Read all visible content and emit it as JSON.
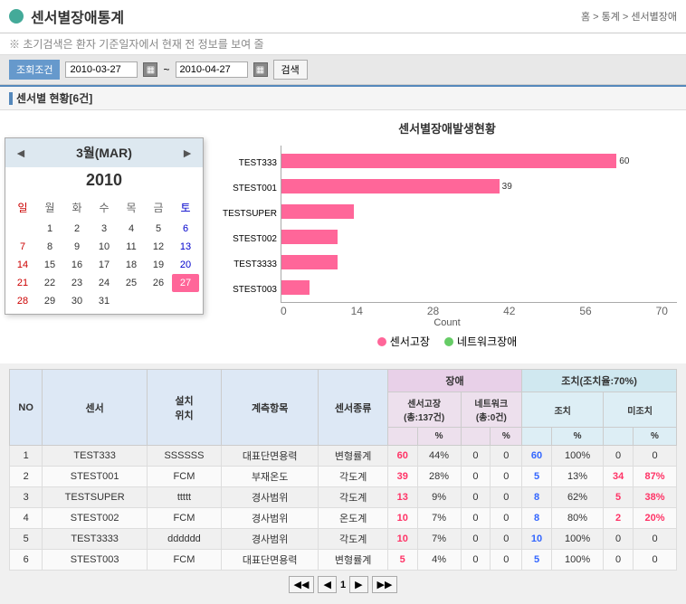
{
  "header": {
    "title": "센서별장애통계",
    "icon_label": "sensor-stats",
    "nav": "홈 > 통계 > 센서별장애",
    "sub_info": "※ 초기검색은 환자 기준일자에서 현재 전 정보를 보여 줄"
  },
  "search": {
    "label": "조회조건",
    "date_from": "2010-03-27",
    "date_to": "2010-04-27",
    "search_btn": "검색"
  },
  "section": {
    "title": "센서별 현황[6건]"
  },
  "calendar": {
    "month": "3월(MAR)",
    "year": "2010",
    "weekdays": [
      "일",
      "월",
      "화",
      "수",
      "목",
      "금",
      "토"
    ],
    "days": [
      {
        "day": "",
        "type": "empty"
      },
      {
        "day": "1",
        "type": ""
      },
      {
        "day": "2",
        "type": ""
      },
      {
        "day": "3",
        "type": ""
      },
      {
        "day": "4",
        "type": ""
      },
      {
        "day": "5",
        "type": ""
      },
      {
        "day": "6",
        "type": "saturday"
      },
      {
        "day": "7",
        "type": "sunday"
      },
      {
        "day": "8",
        "type": ""
      },
      {
        "day": "9",
        "type": ""
      },
      {
        "day": "10",
        "type": ""
      },
      {
        "day": "11",
        "type": ""
      },
      {
        "day": "12",
        "type": ""
      },
      {
        "day": "13",
        "type": "saturday"
      },
      {
        "day": "14",
        "type": "sunday"
      },
      {
        "day": "15",
        "type": ""
      },
      {
        "day": "16",
        "type": ""
      },
      {
        "day": "17",
        "type": ""
      },
      {
        "day": "18",
        "type": ""
      },
      {
        "day": "19",
        "type": ""
      },
      {
        "day": "20",
        "type": "saturday"
      },
      {
        "day": "21",
        "type": "sunday"
      },
      {
        "day": "22",
        "type": ""
      },
      {
        "day": "23",
        "type": ""
      },
      {
        "day": "24",
        "type": ""
      },
      {
        "day": "25",
        "type": ""
      },
      {
        "day": "26",
        "type": ""
      },
      {
        "day": "27",
        "type": "today"
      },
      {
        "day": "28",
        "type": "sunday"
      },
      {
        "day": "29",
        "type": ""
      },
      {
        "day": "30",
        "type": ""
      },
      {
        "day": "31",
        "type": ""
      }
    ]
  },
  "chart": {
    "title": "센서별장애발생현황",
    "x_labels": [
      "28",
      "42",
      "56",
      "70"
    ],
    "x_label_0": "0",
    "count_label": "Count",
    "bars": [
      {
        "label": "TEST333",
        "pink": 60,
        "green": 0,
        "pink_val": "60",
        "green_val": ""
      },
      {
        "label": "STEST001",
        "pink": 39,
        "green": 0,
        "pink_val": "39",
        "green_val": ""
      },
      {
        "label": "TESTSUPER",
        "pink": 13,
        "green": 0,
        "pink_val": "",
        "green_val": ""
      },
      {
        "label": "STEST002",
        "pink": 10,
        "green": 0,
        "pink_val": "",
        "green_val": ""
      },
      {
        "label": "TEST3333",
        "pink": 10,
        "green": 0,
        "pink_val": "",
        "green_val": ""
      },
      {
        "label": "STEST003",
        "pink": 5,
        "green": 0,
        "pink_val": "",
        "green_val": ""
      }
    ],
    "legend": {
      "pink": "센서고장",
      "green": "네트워크장애"
    }
  },
  "table": {
    "headers": {
      "no": "NO",
      "sensor": "센서",
      "location": "설치위치",
      "measure": "계측항목",
      "type": "센서종류",
      "fault_header": "장애",
      "action_header": "조치(조치율:70%)",
      "sensor_fault": "센서고장(총:137건)",
      "pct1": "%",
      "network_fault": "네트워크(총:0건)",
      "pct2": "%",
      "action": "조치",
      "pct3": "%",
      "unaction": "미조치",
      "pct4": "%"
    },
    "rows": [
      {
        "no": "1",
        "sensor": "TEST333",
        "location": "SSSSSS",
        "measure": "대표단면용력",
        "type": "변형률계",
        "sf": "60",
        "sf_pct": "44%",
        "nf": "0",
        "nf_pct": "0",
        "ac": "60",
        "ac_pct": "100%",
        "ua": "0",
        "ua_pct": "0"
      },
      {
        "no": "2",
        "sensor": "STEST001",
        "location": "FCM",
        "measure": "부재온도",
        "type": "각도계",
        "sf": "39",
        "sf_pct": "28%",
        "nf": "0",
        "nf_pct": "0",
        "ac": "5",
        "ac_pct": "13%",
        "ua": "34",
        "ua_pct": "87%"
      },
      {
        "no": "3",
        "sensor": "TESTSUPER",
        "location": "ttttt",
        "measure": "경사범위",
        "type": "각도계",
        "sf": "13",
        "sf_pct": "9%",
        "nf": "0",
        "nf_pct": "0",
        "ac": "8",
        "ac_pct": "62%",
        "ua": "5",
        "ua_pct": "38%"
      },
      {
        "no": "4",
        "sensor": "STEST002",
        "location": "FCM",
        "measure": "경사범위",
        "type": "온도계",
        "sf": "10",
        "sf_pct": "7%",
        "nf": "0",
        "nf_pct": "0",
        "ac": "8",
        "ac_pct": "80%",
        "ua": "2",
        "ua_pct": "20%"
      },
      {
        "no": "5",
        "sensor": "TEST3333",
        "location": "dddddd",
        "measure": "경사범위",
        "type": "각도계",
        "sf": "10",
        "sf_pct": "7%",
        "nf": "0",
        "nf_pct": "0",
        "ac": "10",
        "ac_pct": "100%",
        "ua": "0",
        "ua_pct": "0"
      },
      {
        "no": "6",
        "sensor": "STEST003",
        "location": "FCM",
        "measure": "대표단면용력",
        "type": "변형률계",
        "sf": "5",
        "sf_pct": "4%",
        "nf": "0",
        "nf_pct": "0",
        "ac": "5",
        "ac_pct": "100%",
        "ua": "0",
        "ua_pct": "0"
      }
    ],
    "pagination": {
      "first": "◀◀",
      "prev": "◀",
      "page": "1",
      "next": "▶",
      "last": "▶▶"
    }
  }
}
